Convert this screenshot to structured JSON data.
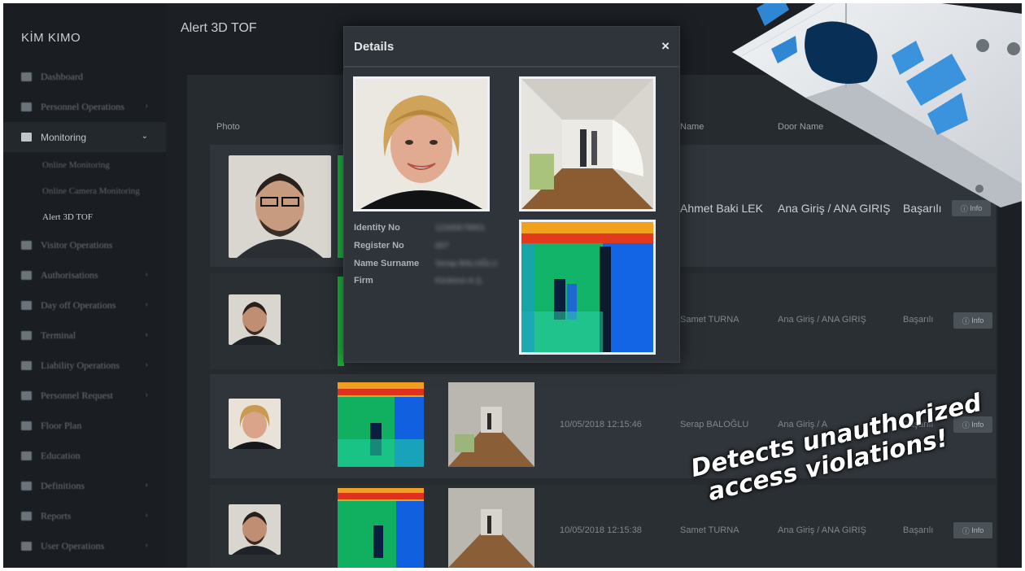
{
  "app": {
    "logo": "KİM KIMO",
    "page_title": "Alert 3D TOF"
  },
  "sidebar": {
    "items": [
      {
        "label": "Dashboard",
        "icon": "dashboard-icon",
        "has_chevron": false
      },
      {
        "label": "Personnel Operations",
        "icon": "users-icon",
        "has_chevron": true
      },
      {
        "label": "Monitoring",
        "icon": "monitor-icon",
        "has_chevron": true,
        "open": true
      },
      {
        "label": "Visitor Operations",
        "icon": "id-card-icon",
        "has_chevron": false
      },
      {
        "label": "Authorisations",
        "icon": "key-icon",
        "has_chevron": true
      },
      {
        "label": "Day off Operations",
        "icon": "calendar-icon",
        "has_chevron": true
      },
      {
        "label": "Terminal",
        "icon": "gear-icon",
        "has_chevron": true
      },
      {
        "label": "Liability Operations",
        "icon": "briefcase-icon",
        "has_chevron": true
      },
      {
        "label": "Personnel Request",
        "icon": "inbox-icon",
        "has_chevron": true
      },
      {
        "label": "Floor Plan",
        "icon": "floor-plan-icon",
        "has_chevron": false
      },
      {
        "label": "Education",
        "icon": "education-icon",
        "has_chevron": false
      },
      {
        "label": "Definitions",
        "icon": "pencil-icon",
        "has_chevron": true
      },
      {
        "label": "Reports",
        "icon": "report-icon",
        "has_chevron": true
      },
      {
        "label": "User Operations",
        "icon": "user-gear-icon",
        "has_chevron": true
      }
    ],
    "monitoring_sub": [
      "Online Monitoring",
      "Online Camera Monitoring",
      "Alert 3D TOF"
    ],
    "active_sub": "Alert 3D TOF"
  },
  "table": {
    "headers": {
      "photo": "Photo",
      "name": "Name",
      "door": "Door Name"
    },
    "rows": [
      {
        "datetime": "",
        "name": "Ahmet Baki LEK",
        "door": "Ana Giriş / ANA GIRIŞ",
        "status": "Başarılı",
        "button": "Info"
      },
      {
        "datetime": "",
        "name": "Samet TURNA",
        "door": "Ana Giriş / ANA GIRIŞ",
        "status": "Başarılı",
        "button": "Info"
      },
      {
        "datetime": "10/05/2018 12:15:46",
        "name": "Serap BALOĞLU",
        "door": "Ana Giriş / A",
        "status": "Başarılı",
        "button": "Info"
      },
      {
        "datetime": "10/05/2018 12:15:38",
        "name": "Samet TURNA",
        "door": "Ana Giriş / ANA GIRIŞ",
        "status": "Başarılı",
        "button": "Info"
      }
    ]
  },
  "modal": {
    "title": "Details",
    "close": "×",
    "fields": [
      {
        "label": "Identity No",
        "value": "12345678901"
      },
      {
        "label": "Register No",
        "value": "007"
      },
      {
        "label": "Name Surname",
        "value": "Serap BALOĞLU"
      },
      {
        "label": "Firm",
        "value": "Kimkimo A.Ş."
      }
    ]
  },
  "caption": {
    "line1": "Detects unauthorized",
    "line2": "access violations!"
  },
  "colors": {
    "background": "#1c2024",
    "panel": "#262b30",
    "row": "#2f353a",
    "modal": "#2e3439",
    "text": "#c9ced3",
    "device_blue": "#3a8fd6",
    "device_body": "#dde1e5"
  }
}
